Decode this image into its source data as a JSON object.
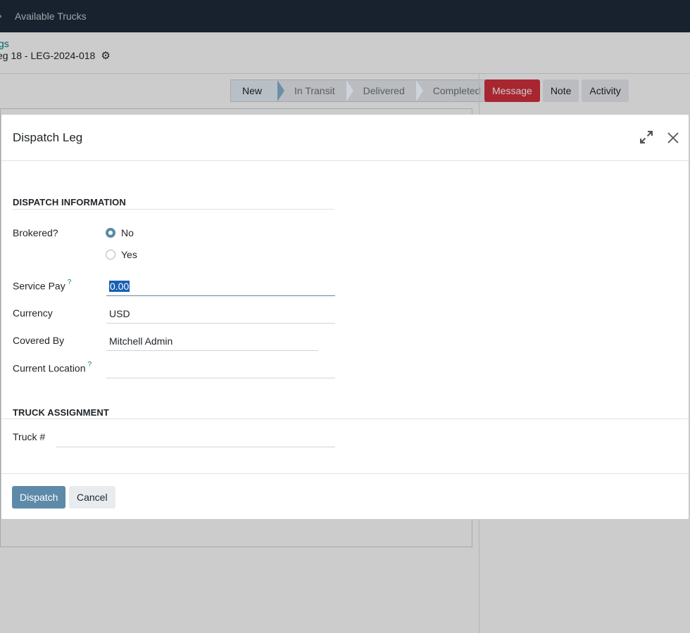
{
  "app": {
    "nav_item": "Available Trucks",
    "breadcrumb_link": "gs",
    "record_title": "eg 18 - LEG-2024-018"
  },
  "statusbar": {
    "stages": [
      "New",
      "In Transit",
      "Delivered",
      "Completed"
    ],
    "active": "New"
  },
  "chatter": {
    "message_label": "Message",
    "note_label": "Note",
    "activity_label": "Activity"
  },
  "dialog": {
    "title": "Dispatch Leg",
    "section_dispatch": "DISPATCH INFORMATION",
    "brokered_label": "Brokered?",
    "brokered_options": [
      "No",
      "Yes"
    ],
    "brokered_selected": "No",
    "service_pay_label": "Service Pay",
    "service_pay_help": "?",
    "service_pay_value": "0.00",
    "currency_label": "Currency",
    "currency_value": "USD",
    "covered_by_label": "Covered By",
    "covered_by_value": "Mitchell Admin",
    "current_location_label": "Current Location",
    "current_location_help": "?",
    "current_location_value": "",
    "section_truck": "TRUCK ASSIGNMENT",
    "truck_label": "Truck #",
    "truck_value": "",
    "dispatch_label": "Dispatch",
    "cancel_label": "Cancel"
  },
  "colors": {
    "navbar": "#1e2b3a",
    "primary": "#5d8aa8",
    "message_button": "#d1303d",
    "link": "#017e84"
  }
}
